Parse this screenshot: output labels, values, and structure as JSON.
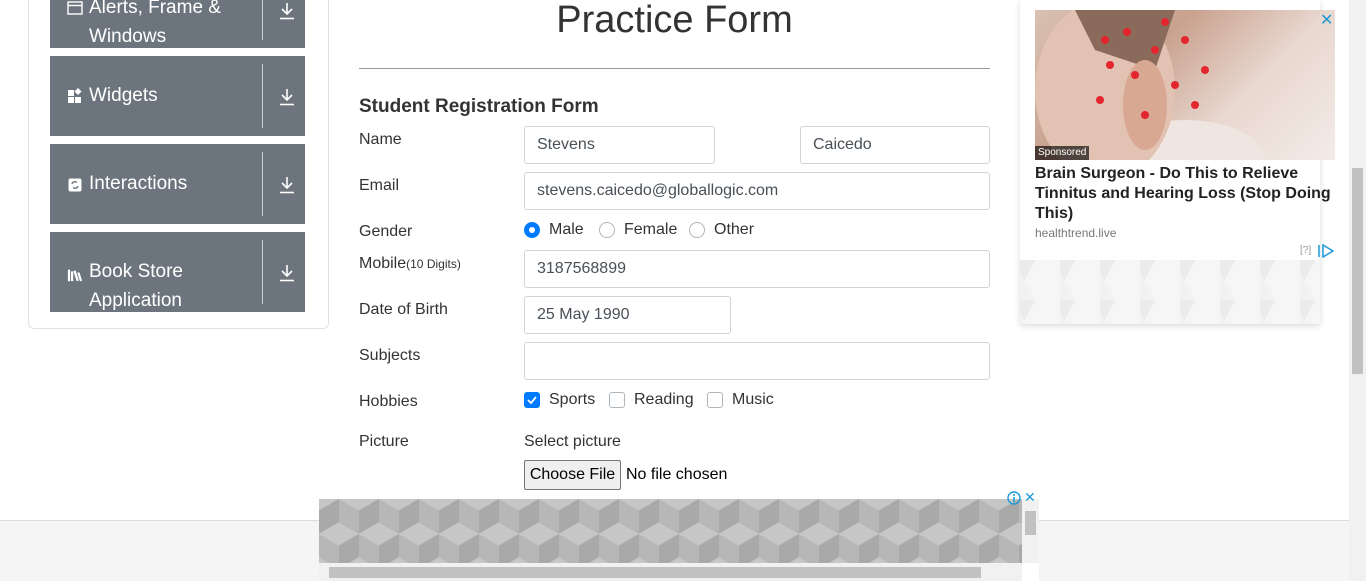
{
  "sidebar": {
    "groups": [
      {
        "label_line1": "Alerts, Frame &",
        "label_line2": "Windows",
        "icon": "window-icon"
      },
      {
        "label": "Widgets",
        "icon": "widgets-icon"
      },
      {
        "label": "Interactions",
        "icon": "interactions-icon"
      },
      {
        "label_line1": "Book Store",
        "label_line2": "Application",
        "icon": "books-icon"
      }
    ]
  },
  "main": {
    "page_title": "Practice Form",
    "form_title": "Student Registration Form",
    "labels": {
      "name": "Name",
      "email": "Email",
      "gender": "Gender",
      "mobile": "Mobile",
      "mobile_hint": "(10 Digits)",
      "dob": "Date of Birth",
      "subjects": "Subjects",
      "hobbies": "Hobbies",
      "picture": "Picture"
    },
    "values": {
      "first_name": "Stevens",
      "last_name": "Caicedo",
      "email": "stevens.caicedo@globallogic.com",
      "mobile": "3187568899",
      "dob": "25 May 1990",
      "subjects": ""
    },
    "gender_options": [
      "Male",
      "Female",
      "Other"
    ],
    "gender_selected": "Male",
    "hobby_options": [
      "Sports",
      "Reading",
      "Music"
    ],
    "hobbies_checked": [
      "Sports"
    ],
    "picture": {
      "select_label": "Select picture",
      "button_label": "Choose File",
      "status": "No file chosen"
    }
  },
  "ad": {
    "sponsored": "Sponsored",
    "headline": "Brain Surgeon - Do This to Relieve Tinnitus and Hearing Loss (Stop Doing This)",
    "domain": "healthtrend.live",
    "help": "[?]",
    "close": "✕"
  },
  "colors": {
    "sidebar_bg": "#6c757d",
    "accent": "#007bff",
    "ad_blue": "#1a9ad6"
  }
}
